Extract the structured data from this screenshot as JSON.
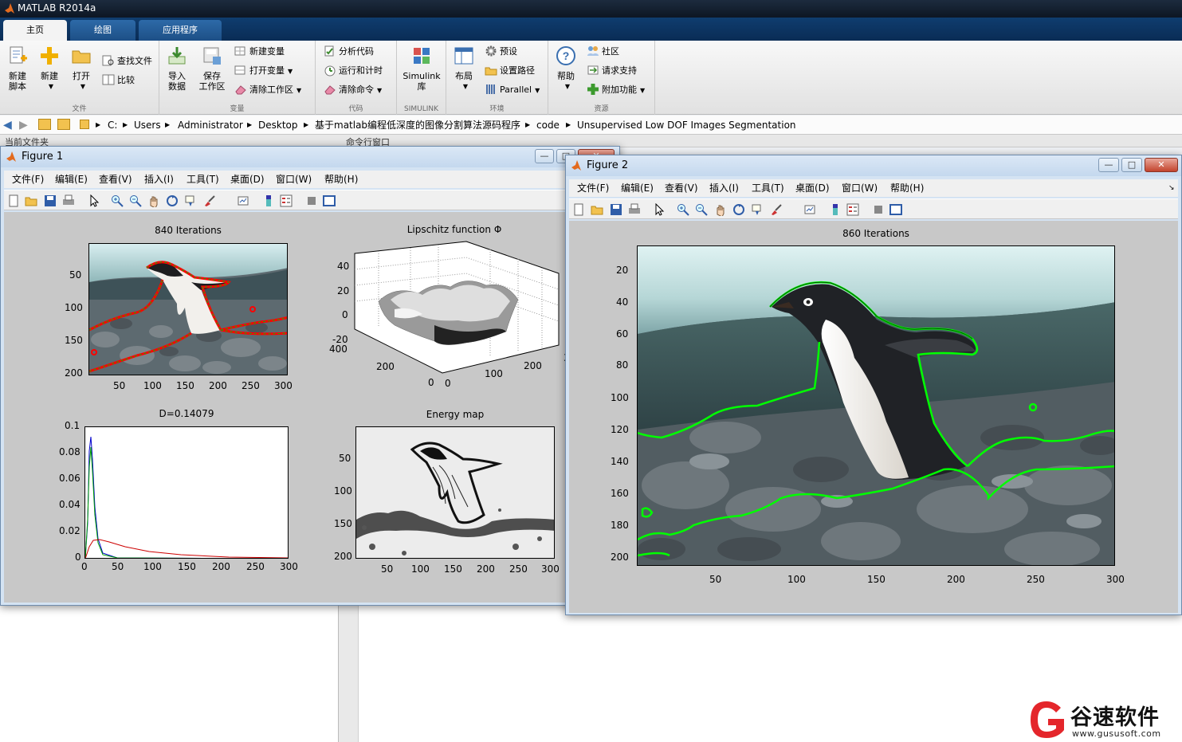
{
  "app": {
    "title": "MATLAB R2014a",
    "tabs": [
      "主页",
      "绘图",
      "应用程序"
    ],
    "active_tab": 0
  },
  "ribbon": {
    "sections": {
      "file": "文件",
      "variable": "变量",
      "code": "代码",
      "simulink": "SIMULINK",
      "environment": "环境",
      "resources": "资源"
    },
    "new_script": [
      "新建",
      "脚本"
    ],
    "new": "新建",
    "open": "打开",
    "find_files": "查找文件",
    "compare": "比较",
    "import": [
      "导入",
      "数据"
    ],
    "save_ws": [
      "保存",
      "工作区"
    ],
    "new_var": "新建变量",
    "open_var": "打开变量",
    "clear_ws": "清除工作区",
    "analyze": "分析代码",
    "run_time": "运行和计时",
    "clear_cmd": "清除命令",
    "simulink": [
      "Simulink",
      "库"
    ],
    "layout": "布局",
    "prefs": "预设",
    "set_path": "设置路径",
    "parallel": "Parallel",
    "help": "帮助",
    "community": "社区",
    "request_support": "请求支持",
    "addons": "附加功能"
  },
  "address": {
    "crumbs": [
      "C:",
      "Users",
      "Administrator",
      "Desktop",
      "基于matlab编程低深度的图像分割算法源码程序",
      "code",
      "Unsupervised Low DOF Images Segmentation"
    ]
  },
  "panes": {
    "current_folder": "当前文件夹",
    "command_window": "命令行窗口"
  },
  "menu": [
    "文件(F)",
    "编辑(E)",
    "查看(V)",
    "插入(I)",
    "工具(T)",
    "桌面(D)",
    "窗口(W)",
    "帮助(H)"
  ],
  "figure1": {
    "title": "Figure 1",
    "subplot1": {
      "title": "840 Iterations",
      "yticks": [
        "50",
        "100",
        "150",
        "200"
      ],
      "xticks": [
        "50",
        "100",
        "150",
        "200",
        "250",
        "300"
      ]
    },
    "subplot2": {
      "title": "Lipschitz function Φ",
      "zticks": [
        "40",
        "20",
        "0",
        "-20"
      ],
      "yticks": [
        "400",
        "200",
        "0"
      ],
      "xticks": [
        "0",
        "100",
        "200",
        "30"
      ]
    },
    "subplot3": {
      "title": "D=0.14079",
      "yticks": [
        "0.1",
        "0.08",
        "0.06",
        "0.04",
        "0.02",
        "0"
      ],
      "xticks": [
        "0",
        "50",
        "100",
        "150",
        "200",
        "250",
        "300"
      ]
    },
    "subplot4": {
      "title": "Energy map",
      "yticks": [
        "50",
        "100",
        "150",
        "200"
      ],
      "xticks": [
        "50",
        "100",
        "150",
        "200",
        "250",
        "300"
      ]
    }
  },
  "figure2": {
    "title": "Figure 2",
    "plot": {
      "title": "860 Iterations",
      "yticks": [
        "20",
        "40",
        "60",
        "80",
        "100",
        "120",
        "140",
        "160",
        "180",
        "200"
      ],
      "xticks": [
        "50",
        "100",
        "150",
        "200",
        "250",
        "300"
      ]
    }
  },
  "watermark": {
    "brand": "谷速软件",
    "url": "www.gususoft.com"
  },
  "colors": {
    "contour_fig1_a": "#ff0000",
    "contour_fig1_b": "#00c000",
    "contour_fig2": "#00ff00",
    "figure_bg": "#c8c8c8",
    "window_frame": "#d4e3f3",
    "brand_red": "#e4262b"
  }
}
